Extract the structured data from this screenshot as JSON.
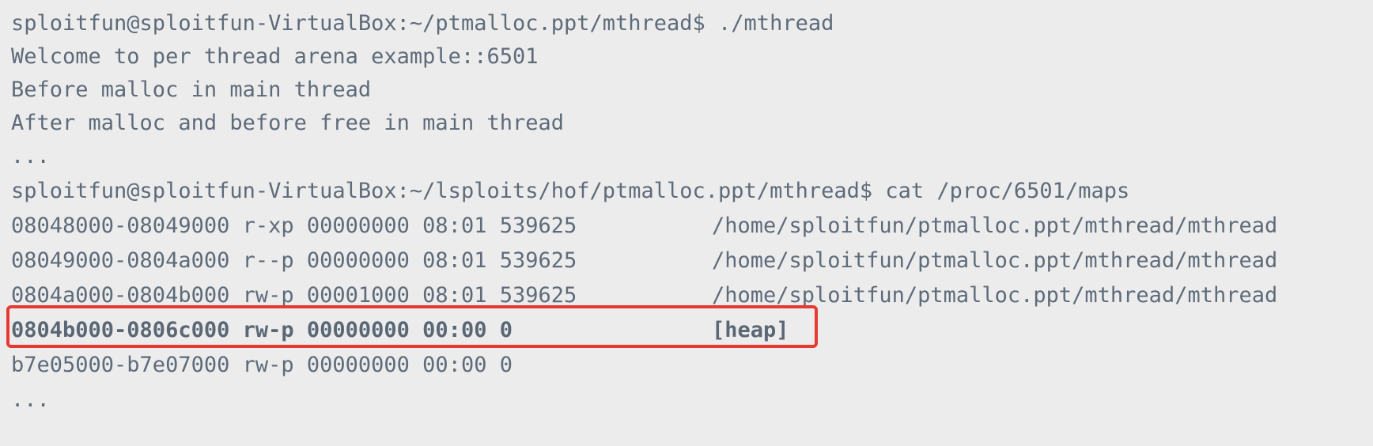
{
  "terminal": {
    "lines": [
      "sploitfun@sploitfun-VirtualBox:~/ptmalloc.ppt/mthread$ ./mthread",
      "Welcome to per thread arena example::6501",
      "Before malloc in main thread",
      "After malloc and before free in main thread",
      "...",
      "sploitfun@sploitfun-VirtualBox:~/lsploits/hof/ptmalloc.ppt/mthread$ cat /proc/6501/maps"
    ],
    "maps": [
      {
        "entry": "08048000-08049000 r-xp 00000000 08:01 539625",
        "path": "/home/sploitfun/ptmalloc.ppt/mthread/mthread"
      },
      {
        "entry": "08049000-0804a000 r--p 00000000 08:01 539625",
        "path": "/home/sploitfun/ptmalloc.ppt/mthread/mthread"
      },
      {
        "entry": "0804a000-0804b000 rw-p 00001000 08:01 539625",
        "path": "/home/sploitfun/ptmalloc.ppt/mthread/mthread"
      },
      {
        "entry": "0804b000-0806c000 rw-p 00000000 00:00 0",
        "path": "[heap]"
      },
      {
        "entry": "b7e05000-b7e07000 rw-p 00000000 00:00 0",
        "path": ""
      }
    ],
    "trailing": "...",
    "highlight_color": "#e53a32",
    "text_color": "#5e6b7a",
    "background": "#ececec"
  }
}
